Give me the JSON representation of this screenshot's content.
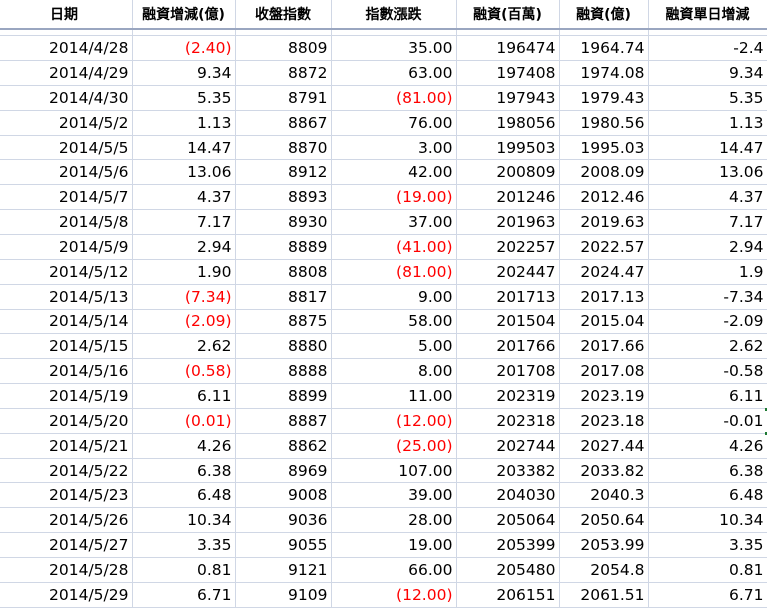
{
  "headers": [
    "日期",
    "融資增減(億)",
    "收盤指數",
    "指數漲跌",
    "融資(百萬)",
    "融資(億)",
    "融資單日增減"
  ],
  "rows": [
    {
      "date": "2014/4/28",
      "chg": "(2.40)",
      "chg_neg": true,
      "close": "8809",
      "idx": "35.00",
      "idx_neg": false,
      "mil": "196474",
      "yi": "1964.74",
      "daily": "-2.4"
    },
    {
      "date": "2014/4/29",
      "chg": "9.34",
      "chg_neg": false,
      "close": "8872",
      "idx": "63.00",
      "idx_neg": false,
      "mil": "197408",
      "yi": "1974.08",
      "daily": "9.34"
    },
    {
      "date": "2014/4/30",
      "chg": "5.35",
      "chg_neg": false,
      "close": "8791",
      "idx": "(81.00)",
      "idx_neg": true,
      "mil": "197943",
      "yi": "1979.43",
      "daily": "5.35"
    },
    {
      "date": "2014/5/2",
      "chg": "1.13",
      "chg_neg": false,
      "close": "8867",
      "idx": "76.00",
      "idx_neg": false,
      "mil": "198056",
      "yi": "1980.56",
      "daily": "1.13"
    },
    {
      "date": "2014/5/5",
      "chg": "14.47",
      "chg_neg": false,
      "close": "8870",
      "idx": "3.00",
      "idx_neg": false,
      "mil": "199503",
      "yi": "1995.03",
      "daily": "14.47"
    },
    {
      "date": "2014/5/6",
      "chg": "13.06",
      "chg_neg": false,
      "close": "8912",
      "idx": "42.00",
      "idx_neg": false,
      "mil": "200809",
      "yi": "2008.09",
      "daily": "13.06"
    },
    {
      "date": "2014/5/7",
      "chg": "4.37",
      "chg_neg": false,
      "close": "8893",
      "idx": "(19.00)",
      "idx_neg": true,
      "mil": "201246",
      "yi": "2012.46",
      "daily": "4.37"
    },
    {
      "date": "2014/5/8",
      "chg": "7.17",
      "chg_neg": false,
      "close": "8930",
      "idx": "37.00",
      "idx_neg": false,
      "mil": "201963",
      "yi": "2019.63",
      "daily": "7.17"
    },
    {
      "date": "2014/5/9",
      "chg": "2.94",
      "chg_neg": false,
      "close": "8889",
      "idx": "(41.00)",
      "idx_neg": true,
      "mil": "202257",
      "yi": "2022.57",
      "daily": "2.94"
    },
    {
      "date": "2014/5/12",
      "chg": "1.90",
      "chg_neg": false,
      "close": "8808",
      "idx": "(81.00)",
      "idx_neg": true,
      "mil": "202447",
      "yi": "2024.47",
      "daily": "1.9"
    },
    {
      "date": "2014/5/13",
      "chg": "(7.34)",
      "chg_neg": true,
      "close": "8817",
      "idx": "9.00",
      "idx_neg": false,
      "mil": "201713",
      "yi": "2017.13",
      "daily": "-7.34"
    },
    {
      "date": "2014/5/14",
      "chg": "(2.09)",
      "chg_neg": true,
      "close": "8875",
      "idx": "58.00",
      "idx_neg": false,
      "mil": "201504",
      "yi": "2015.04",
      "daily": "-2.09"
    },
    {
      "date": "2014/5/15",
      "chg": "2.62",
      "chg_neg": false,
      "close": "8880",
      "idx": "5.00",
      "idx_neg": false,
      "mil": "201766",
      "yi": "2017.66",
      "daily": "2.62"
    },
    {
      "date": "2014/5/16",
      "chg": "(0.58)",
      "chg_neg": true,
      "close": "8888",
      "idx": "8.00",
      "idx_neg": false,
      "mil": "201708",
      "yi": "2017.08",
      "daily": "-0.58"
    },
    {
      "date": "2014/5/19",
      "chg": "6.11",
      "chg_neg": false,
      "close": "8899",
      "idx": "11.00",
      "idx_neg": false,
      "mil": "202319",
      "yi": "2023.19",
      "daily": "6.11"
    },
    {
      "date": "2014/5/20",
      "chg": "(0.01)",
      "chg_neg": true,
      "close": "8887",
      "idx": "(12.00)",
      "idx_neg": true,
      "mil": "202318",
      "yi": "2023.18",
      "daily": "-0.01"
    },
    {
      "date": "2014/5/21",
      "chg": "4.26",
      "chg_neg": false,
      "close": "8862",
      "idx": "(25.00)",
      "idx_neg": true,
      "mil": "202744",
      "yi": "2027.44",
      "daily": "4.26"
    },
    {
      "date": "2014/5/22",
      "chg": "6.38",
      "chg_neg": false,
      "close": "8969",
      "idx": "107.00",
      "idx_neg": false,
      "mil": "203382",
      "yi": "2033.82",
      "daily": "6.38"
    },
    {
      "date": "2014/5/23",
      "chg": "6.48",
      "chg_neg": false,
      "close": "9008",
      "idx": "39.00",
      "idx_neg": false,
      "mil": "204030",
      "yi": "2040.3",
      "daily": "6.48"
    },
    {
      "date": "2014/5/26",
      "chg": "10.34",
      "chg_neg": false,
      "close": "9036",
      "idx": "28.00",
      "idx_neg": false,
      "mil": "205064",
      "yi": "2050.64",
      "daily": "10.34"
    },
    {
      "date": "2014/5/27",
      "chg": "3.35",
      "chg_neg": false,
      "close": "9055",
      "idx": "19.00",
      "idx_neg": false,
      "mil": "205399",
      "yi": "2053.99",
      "daily": "3.35"
    },
    {
      "date": "2014/5/28",
      "chg": "0.81",
      "chg_neg": false,
      "close": "9121",
      "idx": "66.00",
      "idx_neg": false,
      "mil": "205480",
      "yi": "2054.8",
      "daily": "0.81"
    },
    {
      "date": "2014/5/29",
      "chg": "6.71",
      "chg_neg": false,
      "close": "9109",
      "idx": "(12.00)",
      "idx_neg": true,
      "mil": "206151",
      "yi": "2061.51",
      "daily": "6.71"
    }
  ],
  "colors": {
    "negative": "#ff0000",
    "gridline": "#d0d7e5",
    "header_border": "#9aa6c0"
  }
}
